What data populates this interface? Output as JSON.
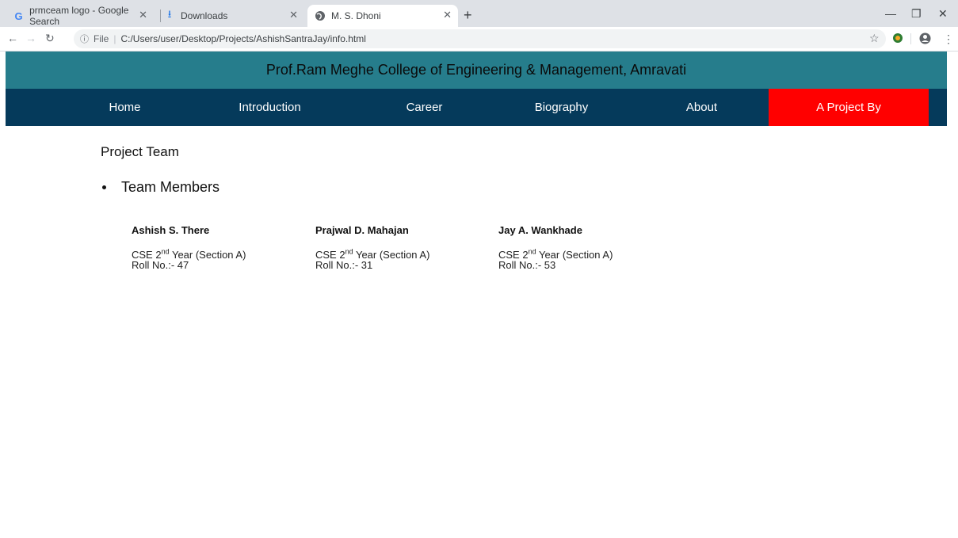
{
  "browser": {
    "tabs": [
      {
        "title": "prmceam logo - Google Search",
        "icon": "google-g-icon"
      },
      {
        "title": "Downloads",
        "icon": "download-icon"
      },
      {
        "title": "M. S. Dhoni",
        "icon": "globe-icon"
      }
    ],
    "address": {
      "scheme_label": "File",
      "path": "C:/Users/user/Desktop/Projects/AshishSantraJay/info.html"
    }
  },
  "page": {
    "header_title": "Prof.Ram Meghe College of Engineering & Management, Amravati",
    "nav": [
      {
        "label": "Home"
      },
      {
        "label": "Introduction"
      },
      {
        "label": "Career"
      },
      {
        "label": "Biography"
      },
      {
        "label": "About"
      },
      {
        "label": "A Project By",
        "active": true
      }
    ],
    "active_color": "#ff0000",
    "section_title": "Project Team",
    "subsection_title": "Team Members",
    "members": [
      {
        "name": "Ashish S. There",
        "course_pre": "CSE 2",
        "course_sup": "nd",
        "course_post": " Year (Section A)",
        "roll": "Roll No.:- 47"
      },
      {
        "name": "Prajwal D. Mahajan",
        "course_pre": "CSE 2",
        "course_sup": "nd",
        "course_post": " Year (Section A)",
        "roll": "Roll No.:- 31"
      },
      {
        "name": "Jay A. Wankhade",
        "course_pre": "CSE 2",
        "course_sup": "nd",
        "course_post": " Year (Section A)",
        "roll": "Roll No.:- 53"
      }
    ]
  }
}
